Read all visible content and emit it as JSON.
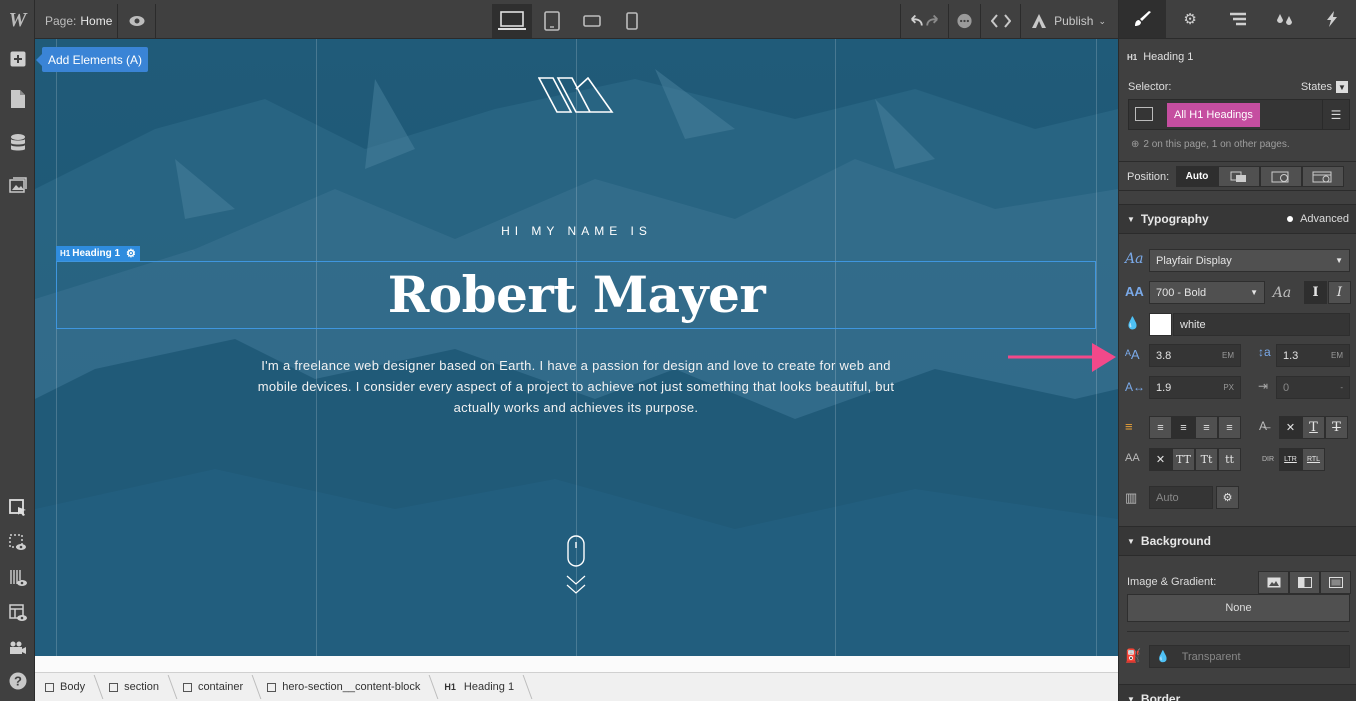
{
  "topbar": {
    "page_prefix": "Page:",
    "page_name": "Home",
    "publish_label": "Publish"
  },
  "tooltip": {
    "add_elements": "Add Elements (A)"
  },
  "canvas": {
    "intro": "HI MY NAME IS",
    "heading": "Robert Mayer",
    "description": "I'm a freelance web designer based on Earth. I have a passion for design and love to create for web and mobile devices. I consider every aspect of a project to achieve not just something that looks beautiful, but actually works and achieves its purpose.",
    "heading_badge_tag": "H1",
    "heading_badge_label": "Heading 1"
  },
  "breadcrumb": [
    {
      "label": "Body"
    },
    {
      "label": "section"
    },
    {
      "label": "container"
    },
    {
      "label": "hero-section__content-block"
    },
    {
      "label": "Heading 1",
      "tag": "H1"
    }
  ],
  "panel": {
    "element_tag": "H1",
    "element_name": "Heading 1",
    "selector_label": "Selector:",
    "states_label": "States",
    "selector_chip": "All H1 Headings",
    "page_note": "2 on this page, 1 on other pages.",
    "position_label": "Position:",
    "position_auto": "Auto",
    "typography": {
      "title": "Typography",
      "advanced": "Advanced",
      "font_family": "Playfair Display",
      "font_weight": "700 - Bold",
      "color": "white",
      "font_size": "3.8",
      "font_size_unit": "EM",
      "line_height": "1.3",
      "line_height_unit": "EM",
      "letter_spacing": "1.9",
      "letter_spacing_unit": "PX",
      "text_indent": "0",
      "text_indent_unit": "-",
      "columns": "Auto",
      "case_tt": "TT",
      "case_cap": "Tt",
      "case_lower": "tt",
      "dir": "DIR",
      "ltr": "LTR",
      "rtl": "RTL",
      "aa": "AA"
    },
    "background": {
      "title": "Background",
      "image_gradient_label": "Image & Gradient:",
      "none": "None",
      "color": "Transparent"
    },
    "border": {
      "title": "Border"
    }
  },
  "colors": {
    "canvas_bg": "#1f5a78",
    "selector_chip": "#c54ea0",
    "accent_blue": "#3a84d6",
    "annotation_arrow": "#f2498a"
  }
}
